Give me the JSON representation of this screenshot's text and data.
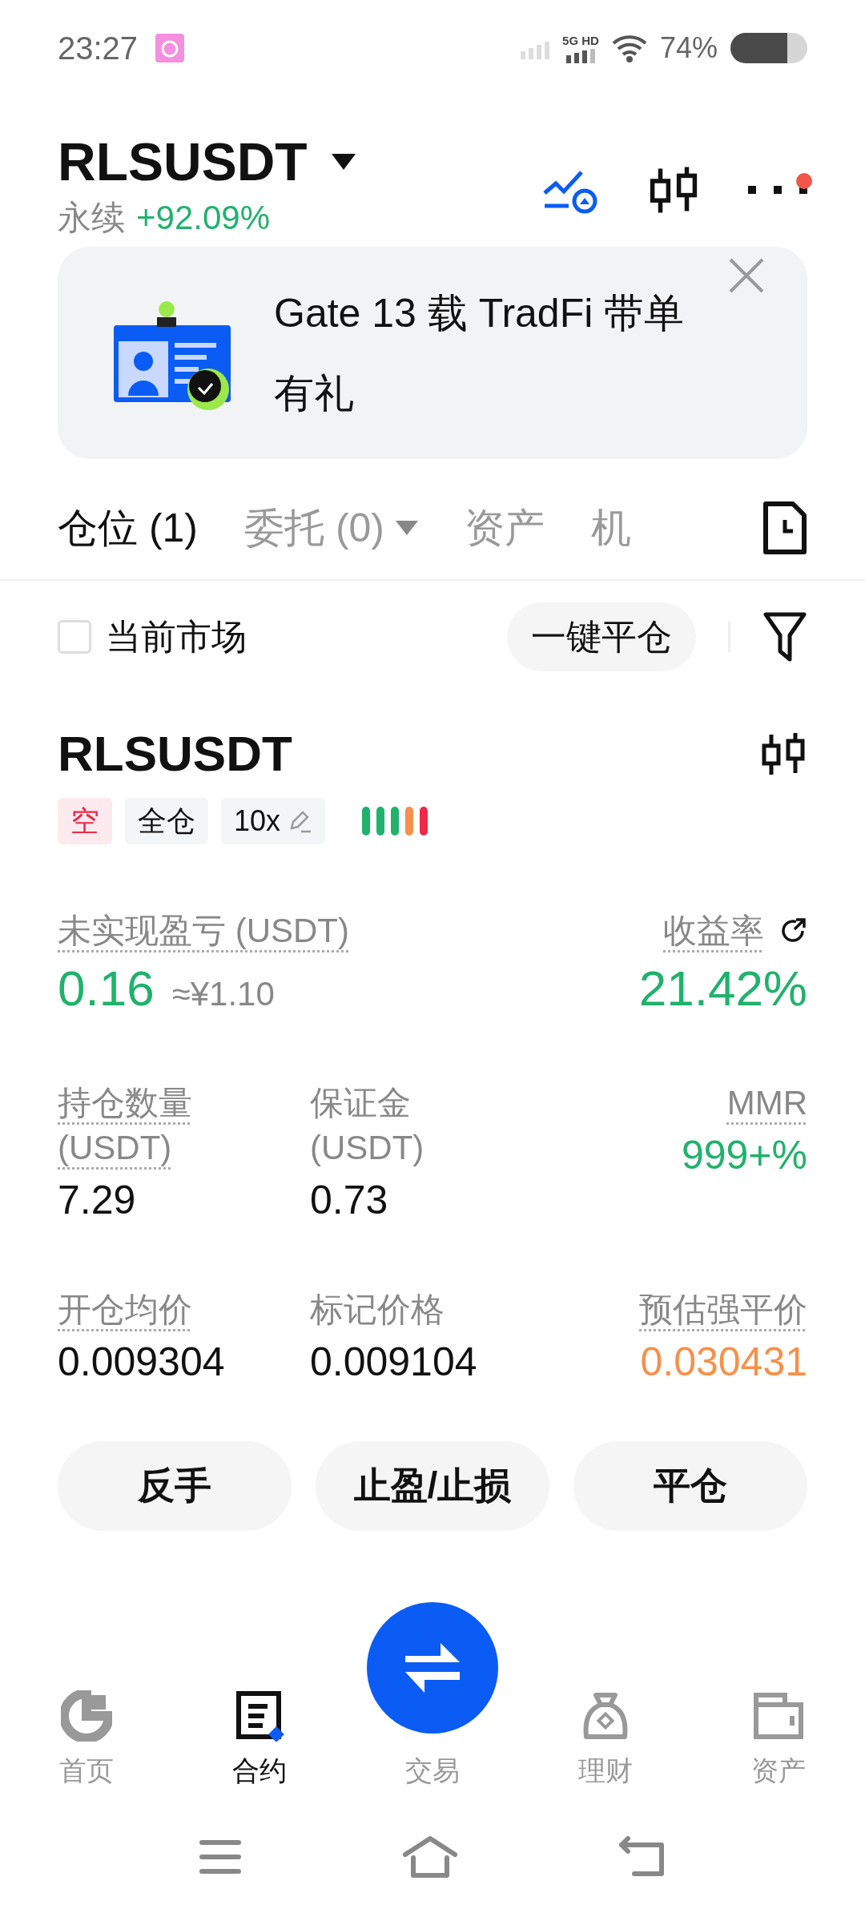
{
  "status_bar": {
    "time": "23:27",
    "network": "5G HD",
    "battery": "74%"
  },
  "header": {
    "symbol": "RLSUSDT",
    "type": "永续",
    "change": "+92.09%",
    "notification_dot": true
  },
  "banner": {
    "text": "Gate 13 载 TradFi 带单有礼"
  },
  "tabs": [
    {
      "label": "仓位 (1)",
      "selected": true,
      "dropdown": false
    },
    {
      "label": "委托 (0)",
      "selected": false,
      "dropdown": true
    },
    {
      "label": "资产",
      "selected": false,
      "dropdown": false
    },
    {
      "label": "机",
      "selected": false,
      "dropdown": false
    }
  ],
  "filter": {
    "label": "当前市场",
    "checked": false,
    "close_all": "一键平仓"
  },
  "position": {
    "symbol": "RLSUSDT",
    "tags": [
      {
        "label": "空",
        "kind": "side"
      },
      {
        "label": "全仓",
        "kind": "plain"
      },
      {
        "label": "10x",
        "kind": "leverage"
      }
    ],
    "risk_bars": [
      {
        "color": "#20b26c"
      },
      {
        "color": "#20b26c"
      },
      {
        "color": "#20b26c"
      },
      {
        "color": "#f7904a"
      },
      {
        "color": "#f0284a"
      }
    ],
    "stats": [
      [
        {
          "label": "未实现盈亏 (USDT)",
          "underlined": true,
          "value": "0.16",
          "approx": "≈¥1.10",
          "kind": "profit"
        },
        {
          "label": "收益率",
          "underlined": true,
          "share_icon": true,
          "value": "21.42%",
          "kind": "profit"
        }
      ],
      [
        {
          "label": "持仓数量",
          "unit": "(USDT)",
          "underlined": true,
          "value": "7.29",
          "kind": "plain"
        },
        {
          "label": "保证金",
          "unit": "(USDT)",
          "underlined": false,
          "value": "0.73",
          "kind": "plain"
        },
        {
          "label": "MMR",
          "underlined": true,
          "value": "999+%",
          "kind": "profit"
        }
      ],
      [
        {
          "label": "开仓均价",
          "underlined": true,
          "value": "0.009304",
          "kind": "plain"
        },
        {
          "label": "标记价格",
          "underlined": false,
          "value": "0.009104",
          "kind": "plain"
        },
        {
          "label": "预估强平价",
          "underlined": true,
          "value": "0.030431",
          "kind": "warning"
        }
      ]
    ],
    "actions": [
      "反手",
      "止盈/止损",
      "平仓"
    ]
  },
  "bottom_nav": [
    {
      "label": "首页",
      "kind": "home",
      "selected": false
    },
    {
      "label": "合约",
      "kind": "futures",
      "selected": true
    },
    {
      "label": "交易",
      "kind": "trade",
      "selected": false
    },
    {
      "label": "理财",
      "kind": "earn",
      "selected": false
    },
    {
      "label": "资产",
      "kind": "assets",
      "selected": false
    }
  ]
}
